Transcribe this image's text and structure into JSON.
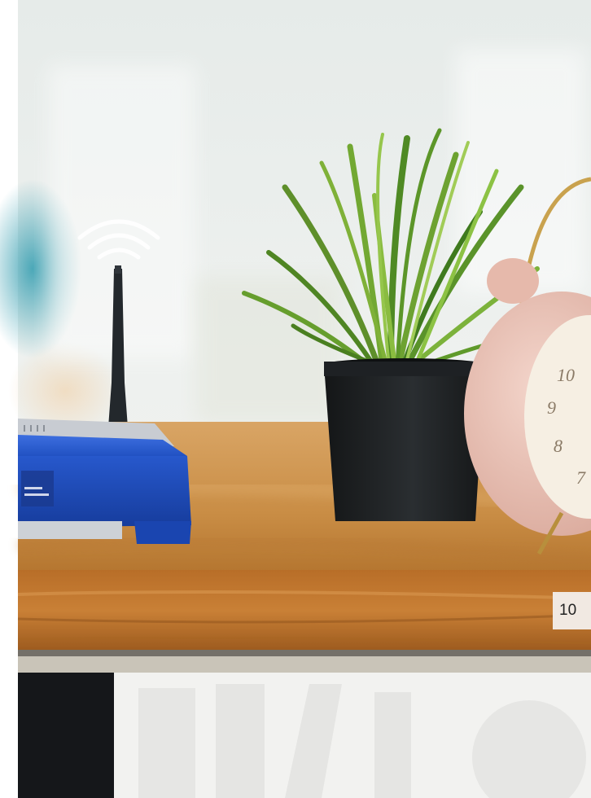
{
  "photo": {
    "subject": "router-plant-clock-on-desk",
    "colors": {
      "router": "#2456c8",
      "pot": "#1f2224",
      "plant": "#5f9a2a",
      "clock": "#e9c3b8",
      "desk": "#c88a42"
    }
  },
  "badge": {
    "text": "10"
  },
  "clock_numerals": [
    "10",
    "9",
    "8",
    "7"
  ]
}
